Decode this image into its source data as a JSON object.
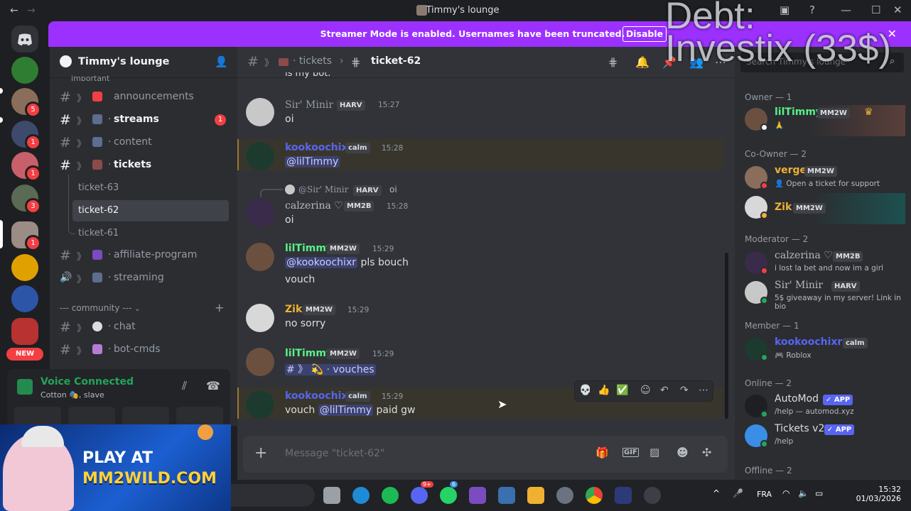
{
  "window": {
    "title": "Timmy's lounge"
  },
  "banner": {
    "text": "Streamer Mode is enabled. Usernames have been truncated.",
    "button": "Disable"
  },
  "overlay": {
    "line1": "Debt:",
    "line2": "Investix (33$)"
  },
  "servers": {
    "badges": [
      "5",
      "1",
      "1",
      "3",
      "1"
    ],
    "new_label": "NEW"
  },
  "guild": {
    "name": "Timmy's lounge"
  },
  "channels": {
    "important_cat": "important",
    "items": [
      {
        "name": "announcements",
        "color": "#f23f43"
      },
      {
        "name": "streams",
        "color": "#949ba4",
        "badge": "1"
      },
      {
        "name": "content",
        "color": "#949ba4"
      },
      {
        "name": "tickets",
        "color": "#8c4b4b"
      }
    ],
    "threads": [
      "ticket-63",
      "ticket-62",
      "ticket-61"
    ],
    "affiliate": "affiliate-program",
    "streaming": "streaming",
    "community_cat": "--- community ---",
    "chat": "chat",
    "botcmds": "bot-cmds"
  },
  "voice": {
    "status": "Voice Connected",
    "sub": "Cotton 🎭, slave"
  },
  "ad": {
    "play": "PLAY AT",
    "url": "MM2WILD.COM"
  },
  "chat_header": {
    "parent": "tickets",
    "channel": "ticket-62",
    "search_placeholder": "Search Timmy's lounge"
  },
  "messages": [
    {
      "user": "Sir' Minir",
      "tag": "HARV",
      "time": "15:27",
      "text": "oi"
    },
    {
      "user": "kookoochixr",
      "tag": "calm",
      "time": "15:28",
      "mention": "@lilTimmy"
    },
    {
      "reply_user": "@Sir' Minir",
      "reply_tag": "HARV",
      "reply_text": "oi",
      "user": "calzerina ♡",
      "tag": "MM2B",
      "time": "15:28",
      "text": "oi"
    },
    {
      "user": "lilTimmy",
      "tag": "MM2W",
      "time": "15:29",
      "mention": "@kookoochixr",
      "text": "pls bouch",
      "text2": "vouch"
    },
    {
      "user": "Zik",
      "tag": "MM2W",
      "time": "15:29",
      "text": "no sorry"
    },
    {
      "user": "lilTimmy",
      "tag": "MM2W",
      "time": "15:29",
      "channel_mention": "vouches"
    },
    {
      "user": "kookoochixr",
      "tag": "calm",
      "time": "15:29",
      "text_pre": "vouch",
      "mention": "@lilTimmy",
      "text_post": "paid gw"
    }
  ],
  "scroll_top_text": "is my bot.",
  "input": {
    "placeholder": "Message \"ticket-62\""
  },
  "members": {
    "cat_owner": "Owner — 1",
    "cat_coowner": "Co-Owner — 2",
    "cat_moderator": "Moderator — 2",
    "cat_member": "Member — 1",
    "cat_online": "Online — 2",
    "cat_offline": "Offline — 2",
    "list": [
      {
        "name": "lilTimmy",
        "tag": "MM2W",
        "status": "🙏",
        "color": "#57f287"
      },
      {
        "name": "verge",
        "tag": "MM2W",
        "status": "👤 Open a ticket for support",
        "color": "#f0b132"
      },
      {
        "name": "Zik",
        "tag": "MM2W",
        "status": "",
        "color": "#f0b132"
      },
      {
        "name": "calzerina ♡",
        "tag": "MM2B",
        "status": "i lost la bet and now im a girl",
        "color": "#b5bac1"
      },
      {
        "name": "Sir' Minir",
        "tag": "HARV",
        "status": "5$ giveaway in my server! Link in bio",
        "color": "#b5bac1"
      },
      {
        "name": "kookoochixr",
        "tag": "calm",
        "status": "🎮 Roblox",
        "color": "#5865f2"
      },
      {
        "name": "AutoMod",
        "tag": "✓ APP",
        "status": "/help — automod.xyz",
        "color": "#dbdee1"
      },
      {
        "name": "Tickets v2",
        "tag": "✓ APP",
        "status": "/help",
        "color": "#dbdee1"
      }
    ]
  },
  "taskbar": {
    "lang": "FRA",
    "time": "15:32",
    "date": "01/03/2026",
    "badge_discord": "9+",
    "badge_whatsapp": "6"
  },
  "colors": {
    "blurple": "#5865f2",
    "banner": "#9b30ff",
    "online": "#23a55a"
  }
}
